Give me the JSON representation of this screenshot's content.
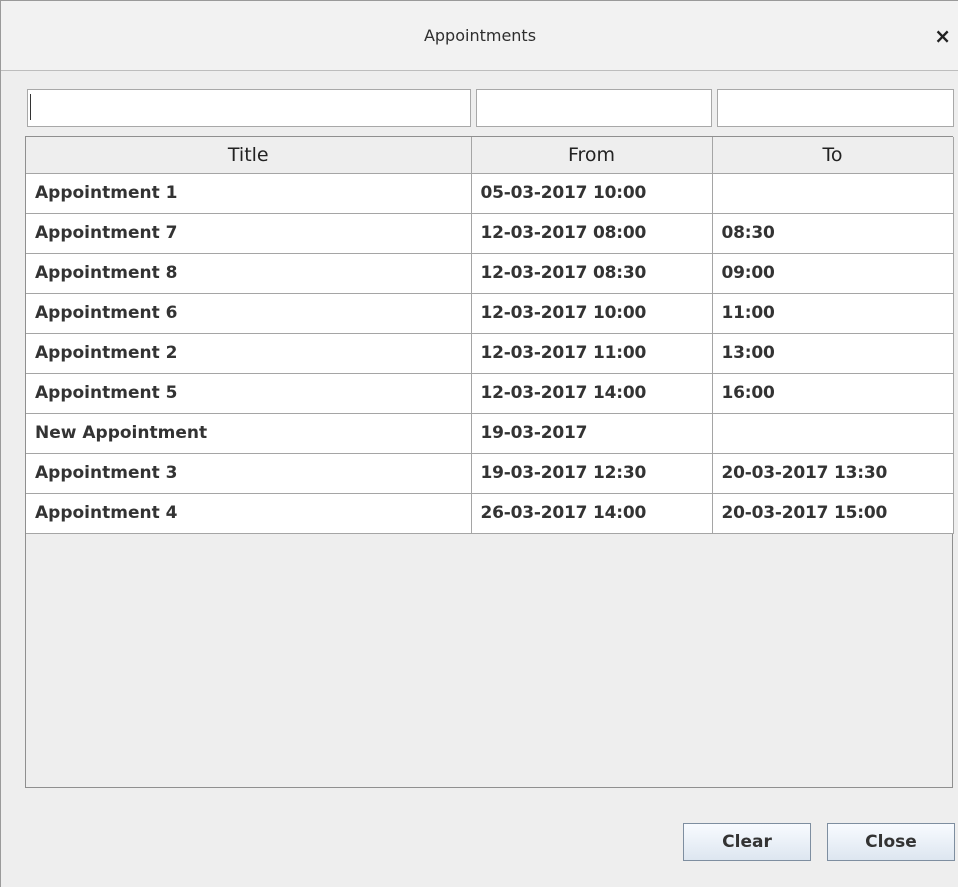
{
  "window": {
    "title": "Appointments",
    "close_glyph": "×"
  },
  "filters": {
    "title_value": "",
    "from_value": "",
    "to_value": ""
  },
  "table": {
    "columns": [
      "Title",
      "From",
      "To"
    ],
    "rows": [
      {
        "title": "Appointment 1",
        "from": "05-03-2017 10:00",
        "to": ""
      },
      {
        "title": "Appointment 7",
        "from": "12-03-2017 08:00",
        "to": "08:30"
      },
      {
        "title": "Appointment 8",
        "from": "12-03-2017 08:30",
        "to": "09:00"
      },
      {
        "title": "Appointment 6",
        "from": "12-03-2017 10:00",
        "to": "11:00"
      },
      {
        "title": "Appointment 2",
        "from": "12-03-2017 11:00",
        "to": "13:00"
      },
      {
        "title": "Appointment 5",
        "from": "12-03-2017 14:00",
        "to": "16:00"
      },
      {
        "title": "New Appointment",
        "from": "19-03-2017",
        "to": ""
      },
      {
        "title": "Appointment 3",
        "from": "19-03-2017 12:30",
        "to": "20-03-2017 13:30"
      },
      {
        "title": "Appointment 4",
        "from": "26-03-2017 14:00",
        "to": "20-03-2017 15:00"
      }
    ]
  },
  "buttons": {
    "clear_label": "Clear",
    "close_label": "Close"
  }
}
